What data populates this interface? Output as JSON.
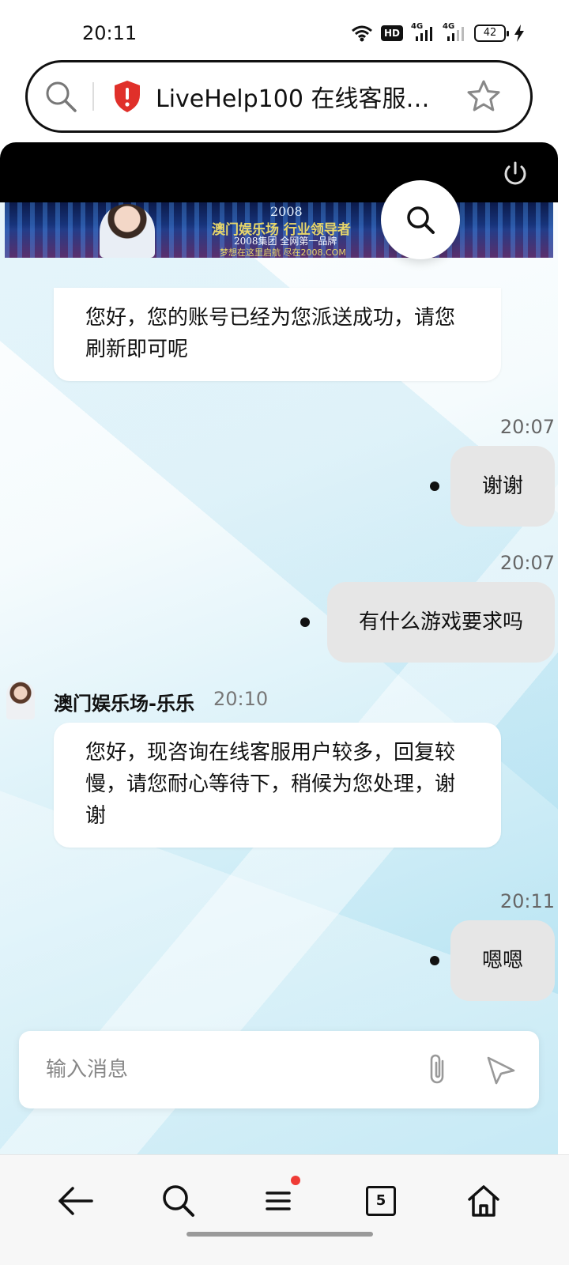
{
  "status_bar": {
    "time": "20:11",
    "network_badge": "HD",
    "network_4g_1": "4G",
    "network_4g_2": "4G",
    "battery": "42"
  },
  "browser": {
    "page_title": "LiveHelp100 在线客服系...",
    "search_icon": "search-icon",
    "shield_icon": "shield-icon",
    "bookmark_icon": "star-icon",
    "shield_color": "#e0302a"
  },
  "chat": {
    "header_bg": "#000000",
    "banner": {
      "brand": "2008",
      "headline": "澳门娱乐场 行业领导者",
      "subline": "2008集团 全网第一品牌",
      "tagline": "梦想在这里启航 尽在2008.COM"
    },
    "messages": {
      "agent_1": {
        "text": "您好，您的账号已经为您派送成功，请您刷新即可呢"
      },
      "user_1": {
        "time": "20:07",
        "text": "谢谢"
      },
      "user_2": {
        "time": "20:07",
        "text": "有什么游戏要求吗"
      },
      "agent_2": {
        "name": "澳门娱乐场-乐乐",
        "time": "20:10",
        "text": "您好，现咨询在线客服用户较多，回复较慢，请您耐心等待下，稍候为您处理，谢谢"
      },
      "user_3": {
        "time": "20:11",
        "text": "嗯嗯"
      }
    },
    "input": {
      "placeholder": "输入消息",
      "value": ""
    }
  },
  "bottom_nav": {
    "tabs_count": "5",
    "items": [
      "back-icon",
      "search-icon",
      "menu-icon",
      "tabs-icon",
      "home-icon"
    ],
    "notification_color": "#ef3b36"
  }
}
